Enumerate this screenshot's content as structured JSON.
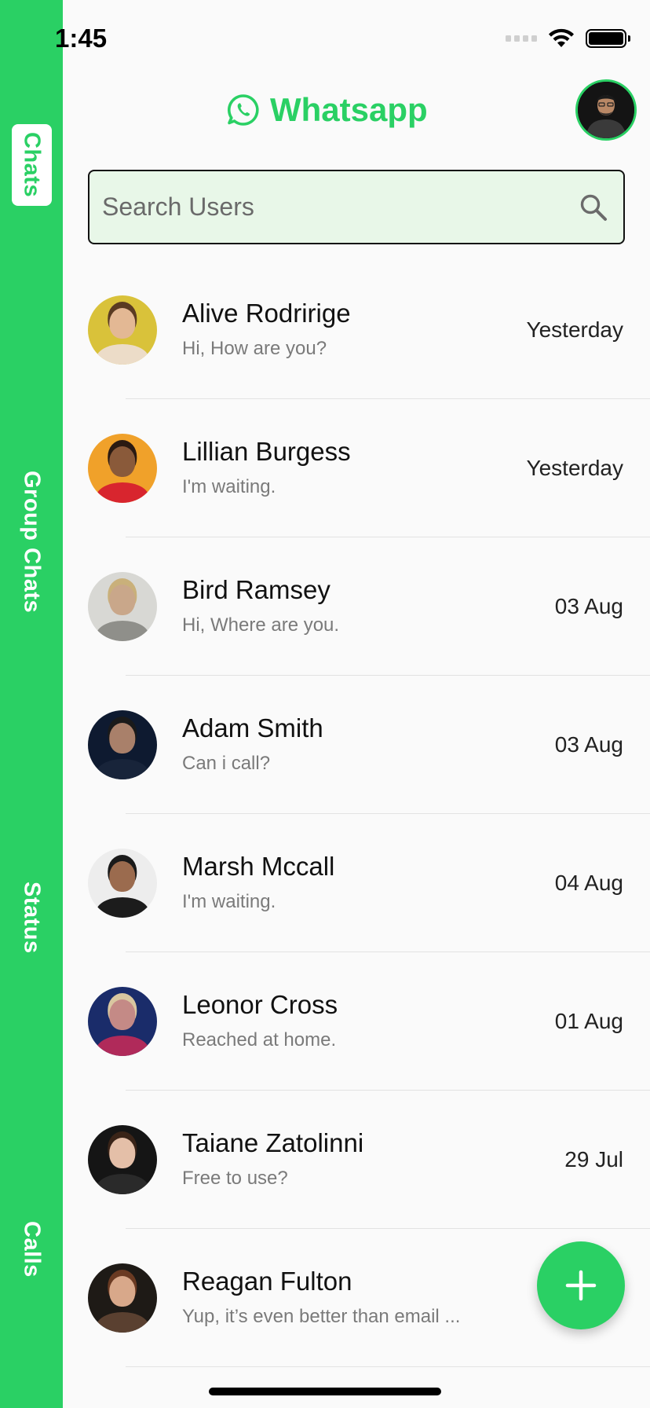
{
  "status_bar": {
    "time": "1:45"
  },
  "side_nav": {
    "tabs": [
      {
        "label": "Chats",
        "active": true
      },
      {
        "label": "Group Chats",
        "active": false
      },
      {
        "label": "Status",
        "active": false
      },
      {
        "label": "Calls",
        "active": false
      }
    ]
  },
  "header": {
    "title": "Whatsapp",
    "logo_icon": "whatsapp-logo-icon",
    "profile_icon": "profile-avatar"
  },
  "search": {
    "placeholder": "Search Users",
    "value": "",
    "icon": "search-icon"
  },
  "chats": [
    {
      "name": "Alive Rodririge",
      "preview": "Hi, How are you?",
      "time": "Yesterday"
    },
    {
      "name": "Lillian Burgess",
      "preview": "I'm waiting.",
      "time": "Yesterday"
    },
    {
      "name": "Bird Ramsey",
      "preview": "Hi, Where are you.",
      "time": "03 Aug"
    },
    {
      "name": "Adam Smith",
      "preview": "Can i call?",
      "time": "03 Aug"
    },
    {
      "name": "Marsh Mccall",
      "preview": "I'm waiting.",
      "time": "04 Aug"
    },
    {
      "name": "Leonor Cross",
      "preview": "Reached at home.",
      "time": "01 Aug"
    },
    {
      "name": "Taiane Zatolinni",
      "preview": "Free to use?",
      "time": "29 Jul"
    },
    {
      "name": "Reagan Fulton",
      "preview": "Yup, it’s even better than email ...",
      "time": ""
    }
  ],
  "fab": {
    "icon": "plus-icon"
  },
  "colors": {
    "accent": "#2ad064",
    "search_bg": "#e8f7e8"
  }
}
